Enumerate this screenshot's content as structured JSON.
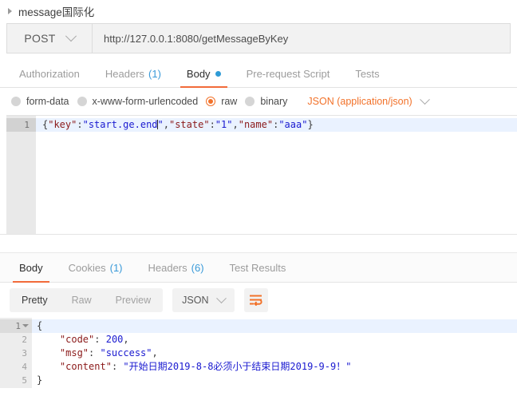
{
  "request": {
    "title": "message国际化",
    "method": "POST",
    "url": "http://127.0.0.1:8080/getMessageByKey",
    "tabs": [
      {
        "label": "Authorization",
        "count": "",
        "active": false,
        "dot": false
      },
      {
        "label": "Headers",
        "count": "(1)",
        "active": false,
        "dot": false
      },
      {
        "label": "Body",
        "count": "",
        "active": true,
        "dot": true
      },
      {
        "label": "Pre-request Script",
        "count": "",
        "active": false,
        "dot": false
      },
      {
        "label": "Tests",
        "count": "",
        "active": false,
        "dot": false
      }
    ],
    "body_types": [
      {
        "label": "form-data",
        "selected": false
      },
      {
        "label": "x-www-form-urlencoded",
        "selected": false
      },
      {
        "label": "raw",
        "selected": true
      },
      {
        "label": "binary",
        "selected": false
      }
    ],
    "content_type": "JSON (application/json)",
    "editor": {
      "line_numbers": [
        "1"
      ],
      "lines": [
        {
          "active": true,
          "tokens": [
            {
              "t": "punc",
              "v": "{"
            },
            {
              "t": "key",
              "v": "\"key\""
            },
            {
              "t": "punc",
              "v": ":"
            },
            {
              "t": "str",
              "v": "\"start.ge.end"
            },
            {
              "t": "caret",
              "v": ""
            },
            {
              "t": "str",
              "v": "\""
            },
            {
              "t": "punc",
              "v": ","
            },
            {
              "t": "key",
              "v": "\"state\""
            },
            {
              "t": "punc",
              "v": ":"
            },
            {
              "t": "str",
              "v": "\"1\""
            },
            {
              "t": "punc",
              "v": ","
            },
            {
              "t": "key",
              "v": "\"name\""
            },
            {
              "t": "punc",
              "v": ":"
            },
            {
              "t": "str",
              "v": "\"aaa\""
            },
            {
              "t": "punc",
              "v": "}"
            }
          ]
        }
      ]
    }
  },
  "response": {
    "tabs": [
      {
        "label": "Body",
        "count": "",
        "active": true
      },
      {
        "label": "Cookies",
        "count": "(1)",
        "active": false
      },
      {
        "label": "Headers",
        "count": "(6)",
        "active": false
      },
      {
        "label": "Test Results",
        "count": "",
        "active": false
      }
    ],
    "view_modes": [
      {
        "label": "Pretty",
        "active": true
      },
      {
        "label": "Raw",
        "active": false
      },
      {
        "label": "Preview",
        "active": false
      }
    ],
    "format": "JSON",
    "wrap_icon": "word-wrap-icon",
    "editor": {
      "line_numbers": [
        "1",
        "2",
        "3",
        "4",
        "5"
      ],
      "lines": [
        {
          "active": true,
          "fold": true,
          "tokens": [
            {
              "t": "punc",
              "v": "{"
            }
          ]
        },
        {
          "active": false,
          "fold": false,
          "tokens": [
            {
              "t": "punc",
              "v": "    "
            },
            {
              "t": "key",
              "v": "\"code\""
            },
            {
              "t": "punc",
              "v": ": "
            },
            {
              "t": "str",
              "v": "200"
            },
            {
              "t": "punc",
              "v": ","
            }
          ]
        },
        {
          "active": false,
          "fold": false,
          "tokens": [
            {
              "t": "punc",
              "v": "    "
            },
            {
              "t": "key",
              "v": "\"msg\""
            },
            {
              "t": "punc",
              "v": ": "
            },
            {
              "t": "str",
              "v": "\"success\""
            },
            {
              "t": "punc",
              "v": ","
            }
          ]
        },
        {
          "active": false,
          "fold": false,
          "tokens": [
            {
              "t": "punc",
              "v": "    "
            },
            {
              "t": "key",
              "v": "\"content\""
            },
            {
              "t": "punc",
              "v": ": "
            },
            {
              "t": "str",
              "v": "\"开始日期2019-8-8必须小于结束日期2019-9-9！\""
            }
          ]
        },
        {
          "active": false,
          "fold": false,
          "tokens": [
            {
              "t": "punc",
              "v": "}"
            }
          ]
        }
      ]
    }
  },
  "colors": {
    "accent": "#f26b3a",
    "link": "#3a9ad9",
    "json_key": "#8b1a1a",
    "json_string": "#1a1ad0",
    "active_line": "#eaf2ff"
  }
}
